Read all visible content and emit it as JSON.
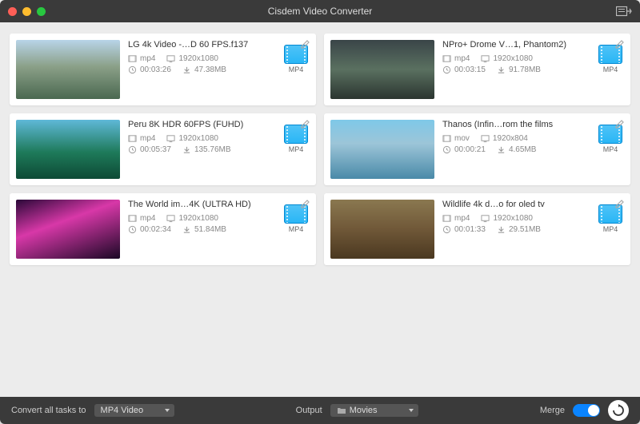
{
  "window": {
    "title": "Cisdem Video Converter"
  },
  "videos": [
    {
      "title": "LG 4k Video -…D 60 FPS.f137",
      "format": "mp4",
      "resolution": "1920x1080",
      "duration": "00:03:26",
      "size": "47.38MB",
      "target": "MP4"
    },
    {
      "title": "NPro+ Drome V…1, Phantom2)",
      "format": "mp4",
      "resolution": "1920x1080",
      "duration": "00:03:15",
      "size": "91.78MB",
      "target": "MP4"
    },
    {
      "title": "Peru 8K HDR 60FPS (FUHD)",
      "format": "mp4",
      "resolution": "1920x1080",
      "duration": "00:05:37",
      "size": "135.76MB",
      "target": "MP4"
    },
    {
      "title": "Thanos (Infin…rom the films",
      "format": "mov",
      "resolution": "1920x804",
      "duration": "00:00:21",
      "size": "4.65MB",
      "target": "MP4"
    },
    {
      "title": "The World im…4K (ULTRA HD)",
      "format": "mp4",
      "resolution": "1920x1080",
      "duration": "00:02:34",
      "size": "51.84MB",
      "target": "MP4"
    },
    {
      "title": "Wildlife 4k d…o for oled tv",
      "format": "mp4",
      "resolution": "1920x1080",
      "duration": "00:01:33",
      "size": "29.51MB",
      "target": "MP4"
    }
  ],
  "bottombar": {
    "convert_label": "Convert all tasks to",
    "convert_value": "MP4 Video",
    "output_label": "Output",
    "output_value": "Movies",
    "merge_label": "Merge"
  }
}
